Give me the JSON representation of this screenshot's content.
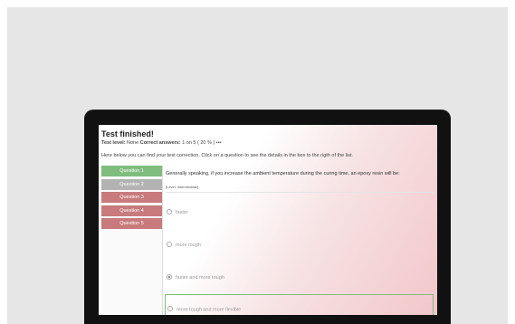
{
  "header": {
    "title": "Test finished!",
    "level_label": "Test level:",
    "level_value": "None",
    "correct_label": "Correct answers:",
    "correct_value": "1 on 5 ( 20 % )",
    "correct_suffix": "•••"
  },
  "instructions": {
    "text_before": "Here below you can find your test correction. Click on a question to see the details in the",
    "text_bold": "box to the rigth of the list."
  },
  "sidebar": {
    "questions": [
      {
        "label": "Question 1",
        "status": "correct"
      },
      {
        "label": "Question 2",
        "status": "selected"
      },
      {
        "label": "Question 3",
        "status": "wrong"
      },
      {
        "label": "Question 4",
        "status": "wrong"
      },
      {
        "label": "Question 5",
        "status": "wrong"
      }
    ]
  },
  "question": {
    "text": "Generally speaking, if you increase the ambient temperature during the curing time, an epoxy resin will be:",
    "level": "[Level: intermediate]",
    "answers": [
      {
        "label": "faster",
        "selected": false,
        "correct": false
      },
      {
        "label": "more tough",
        "selected": false,
        "correct": false
      },
      {
        "label": "faster and more tough",
        "selected": true,
        "correct": false
      },
      {
        "label": "more tough and more flexible",
        "selected": false,
        "correct": true
      }
    ]
  },
  "colors": {
    "correct": "#7fbd7f",
    "selected": "#b3b3b3",
    "wrong": "#c87a7c",
    "accent_gradient": "#f2c6c9"
  }
}
